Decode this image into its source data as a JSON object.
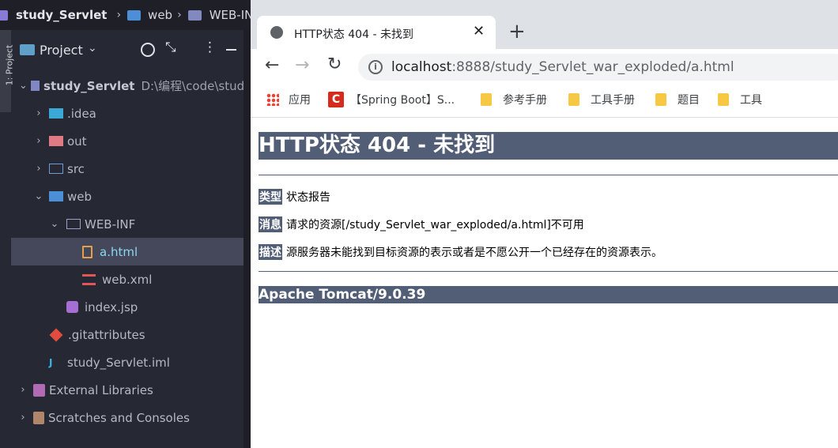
{
  "ide": {
    "breadcrumb": [
      "study_Servlet",
      "web",
      "WEB-INF"
    ],
    "side_tab_label": "1: Project",
    "panel_title": "Project",
    "tree": [
      {
        "name": "study_Servlet",
        "path": "D:\\编程\\code\\study",
        "icon": "module-folder-icon",
        "expanded": true
      },
      {
        "name": ".idea",
        "icon": "idea-folder-icon",
        "expanded": false
      },
      {
        "name": "out",
        "icon": "excluded-folder-icon",
        "expanded": false
      },
      {
        "name": "src",
        "icon": "source-folder-icon",
        "expanded": false
      },
      {
        "name": "web",
        "icon": "web-folder-icon",
        "expanded": true
      },
      {
        "name": "WEB-INF",
        "icon": "folder-icon",
        "expanded": true
      },
      {
        "name": "a.html",
        "icon": "html-file-icon",
        "selected": true
      },
      {
        "name": "web.xml",
        "icon": "xml-file-icon"
      },
      {
        "name": "index.jsp",
        "icon": "jsp-file-icon"
      },
      {
        "name": ".gitattributes",
        "icon": "git-file-icon"
      },
      {
        "name": "study_Servlet.iml",
        "icon": "iml-file-icon"
      },
      {
        "name": "External Libraries",
        "icon": "libraries-icon",
        "expanded": false
      },
      {
        "name": "Scratches and Consoles",
        "icon": "scratches-icon",
        "expanded": false
      }
    ]
  },
  "browser": {
    "tab_title": "HTTP状态 404 - 未找到",
    "url_host": "localhost",
    "url_rest": ":8888/study_Servlet_war_exploded/a.html",
    "bookmarks": [
      "应用",
      "【Spring Boot】S...",
      "参考手册",
      "工具手册",
      "题目",
      "工具"
    ]
  },
  "page": {
    "heading": "HTTP状态 404 - 未找到",
    "type_label": "类型",
    "type_value": "状态报告",
    "message_label": "消息",
    "message_value": "请求的资源[/study_Servlet_war_exploded/a.html]不可用",
    "desc_label": "描述",
    "desc_value": "源服务器未能找到目标资源的表示或者是不愿公开一个已经存在的资源表示。",
    "footer": "Apache Tomcat/9.0.39"
  },
  "colors": {
    "tomcat_bar": "#525d76",
    "ide_bg": "#262833",
    "selection": "#45475a"
  }
}
